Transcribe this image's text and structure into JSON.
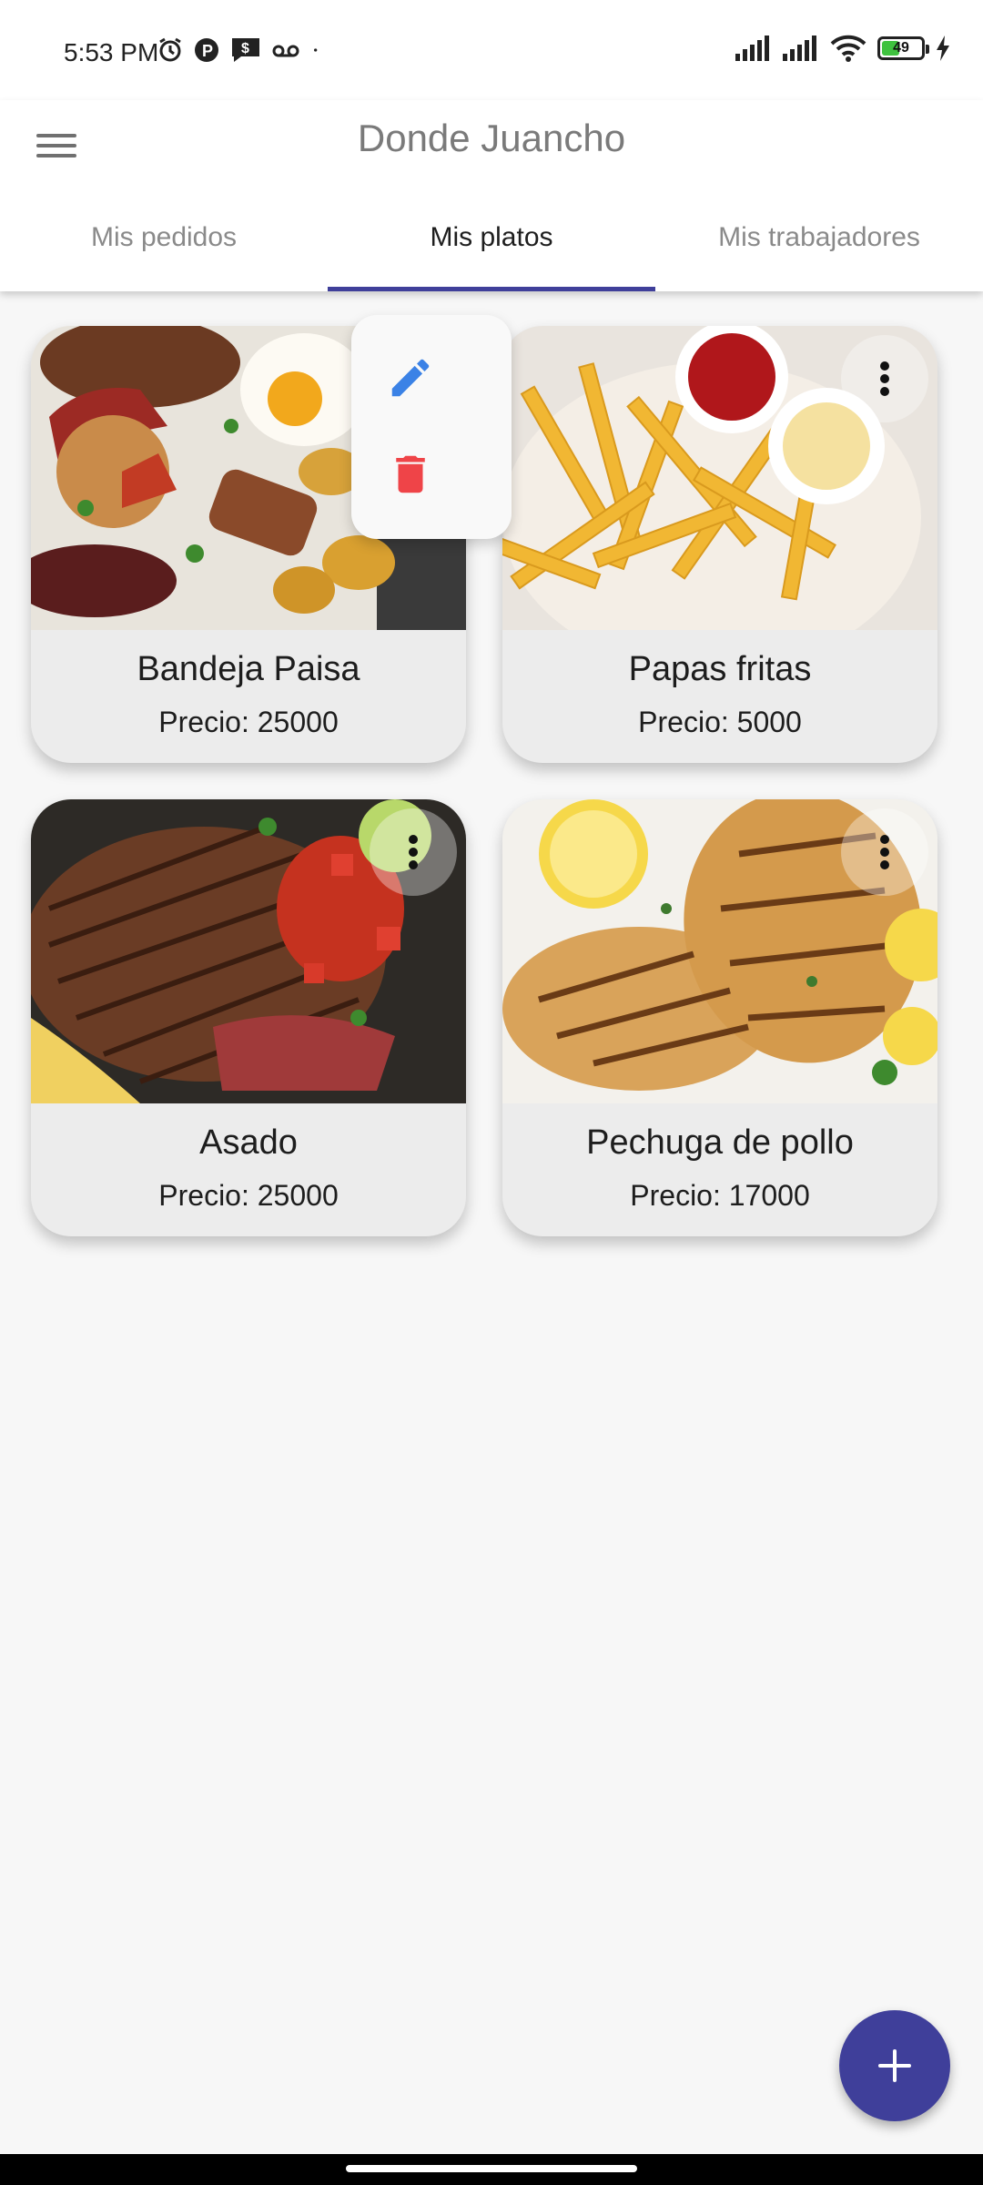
{
  "status_bar": {
    "time": "5:53 PM",
    "battery_level": "49",
    "battery_fraction": 0.49,
    "icons": [
      "alarm-icon",
      "parking-icon",
      "message-icon",
      "voicemail-icon",
      "dot-icon",
      "signal-icon",
      "signal-icon",
      "wifi-icon",
      "battery-icon",
      "charging-icon"
    ]
  },
  "app_bar": {
    "title": "Donde Juancho",
    "menu_icon": "hamburger-menu-icon"
  },
  "tabs": [
    {
      "label": "Mis pedidos",
      "active": false
    },
    {
      "label": "Mis platos",
      "active": true
    },
    {
      "label": "Mis trabajadores",
      "active": false
    }
  ],
  "dishes": [
    {
      "name": "Bandeja Paisa",
      "price": "Precio: 25000"
    },
    {
      "name": "Papas fritas",
      "price": "Precio: 5000"
    },
    {
      "name": "Asado",
      "price": "Precio: 25000"
    },
    {
      "name": "Pechuga de pollo",
      "price": "Precio: 17000"
    }
  ],
  "popup_menu": {
    "items": [
      "edit-icon",
      "delete-icon"
    ]
  },
  "colors": {
    "accent": "#3f3f9a",
    "edit": "#3b82e6",
    "delete": "#ef4448"
  }
}
